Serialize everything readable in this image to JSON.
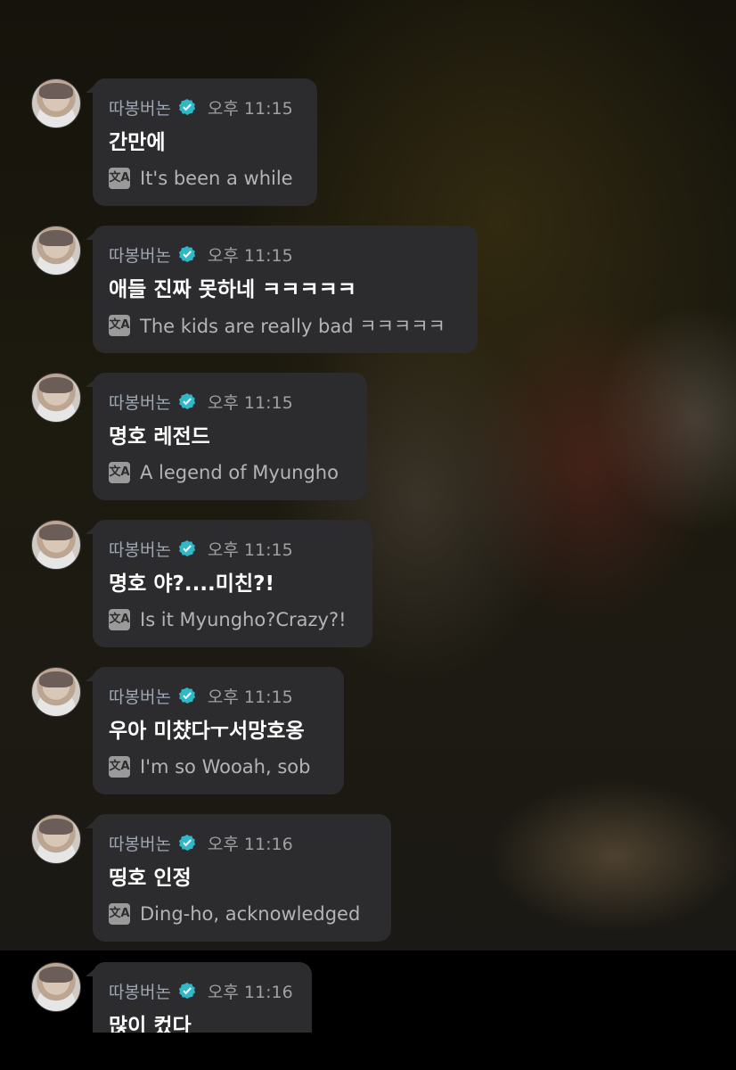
{
  "messages": [
    {
      "sender": "따봉버논",
      "time": "오후 11:15",
      "text": "간만에",
      "translation": "It's been a while",
      "translate_icon": "translate-icon"
    },
    {
      "sender": "따봉버논",
      "time": "오후 11:15",
      "text": "애들 진짜 못하네 ㅋㅋㅋㅋㅋ",
      "translation": "The kids are really bad ㅋㅋㅋㅋㅋ",
      "translate_icon": "translate-icon"
    },
    {
      "sender": "따봉버논",
      "time": "오후 11:15",
      "text": "명호 레전드",
      "translation": "A legend of Myungho",
      "translate_icon": "translate-icon"
    },
    {
      "sender": "따봉버논",
      "time": "오후 11:15",
      "text": "명호 야?....미친?!",
      "translation": "Is it Myungho?Crazy?!",
      "translate_icon": "translate-icon"
    },
    {
      "sender": "따봉버논",
      "time": "오후 11:15",
      "text": "우아 미챴다ㅜ서망호옹",
      "translation": "I'm so Wooah, sob",
      "translate_icon": "translate-icon"
    },
    {
      "sender": "따봉버논",
      "time": "오후 11:16",
      "text": "띵호 인정",
      "translation": "Ding-ho, acknowledged",
      "translate_icon": "translate-icon"
    },
    {
      "sender": "따봉버논",
      "time": "오후 11:16",
      "text": "많이 컸다",
      "translation": "",
      "translate_icon": "translate-icon"
    }
  ],
  "colors": {
    "bubble": "#2c2c2e",
    "verified": "#2fb8c9",
    "sender": "#9da7b5"
  },
  "icons": {
    "verified": "verified-badge-icon",
    "translate": "translate-icon",
    "avatar": "avatar"
  },
  "translate_glyph": "文A"
}
